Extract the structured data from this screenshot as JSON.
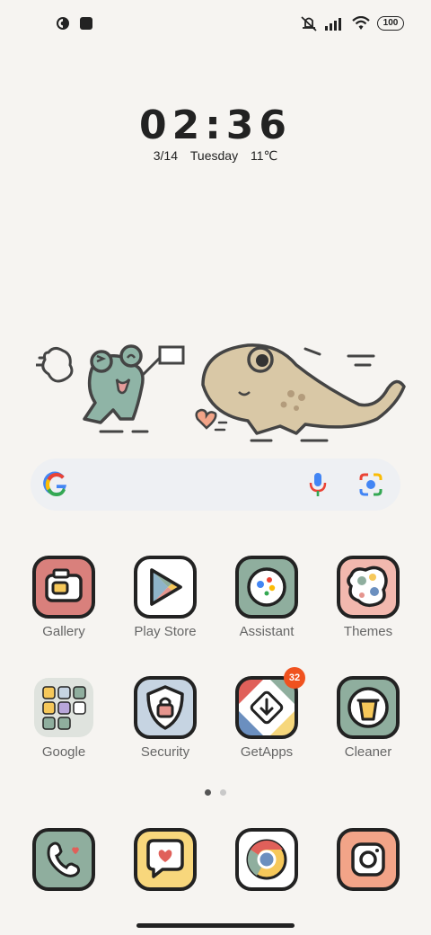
{
  "status_bar": {
    "battery": "100",
    "icons": [
      "notification-app-icon",
      "notification-square-icon",
      "mute-icon",
      "signal-icon",
      "wifi-icon",
      "battery-icon"
    ]
  },
  "clock": {
    "time": "02:36",
    "date": "3/14",
    "weekday": "Tuesday",
    "temperature": "11℃"
  },
  "search": {
    "icons": [
      "google-g-icon",
      "microphone-icon",
      "lens-camera-icon"
    ]
  },
  "apps": [
    {
      "label": "Gallery",
      "icon": "gallery-icon",
      "bg": "#d9807c"
    },
    {
      "label": "Play Store",
      "icon": "play-store-icon",
      "bg": "#ffffff"
    },
    {
      "label": "Assistant",
      "icon": "assistant-icon",
      "bg": "#8fae9e"
    },
    {
      "label": "Themes",
      "icon": "themes-icon",
      "bg": "#f2b8ae"
    },
    {
      "label": "Google",
      "icon": "google-folder-icon",
      "bg": "#dfe3de"
    },
    {
      "label": "Security",
      "icon": "security-icon",
      "bg": "#c6d4e2"
    },
    {
      "label": "GetApps",
      "icon": "getapps-icon",
      "bg": "#ffffff",
      "badge": "32"
    },
    {
      "label": "Cleaner",
      "icon": "cleaner-icon",
      "bg": "#8fae9e"
    }
  ],
  "dock": [
    {
      "icon": "phone-icon",
      "bg": "#8fae9e"
    },
    {
      "icon": "messages-icon",
      "bg": "#f8d77c"
    },
    {
      "icon": "chrome-icon",
      "bg": "#ffffff"
    },
    {
      "icon": "camera-icon",
      "bg": "#f2a488"
    }
  ],
  "page_indicator": {
    "pages": 2,
    "current": 1
  }
}
